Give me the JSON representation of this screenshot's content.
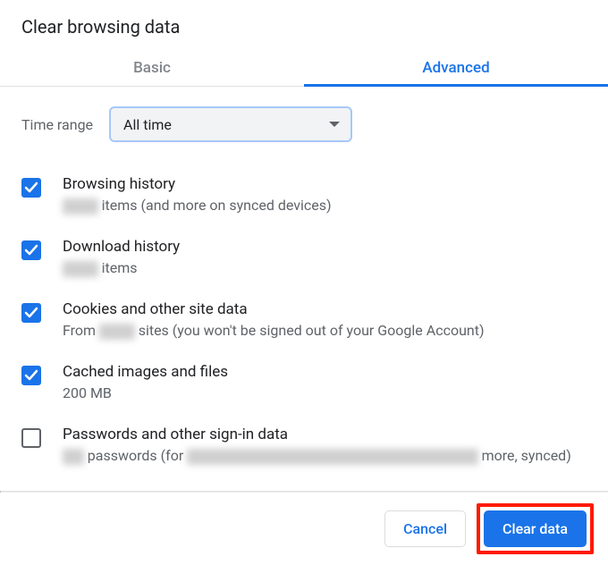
{
  "dialog": {
    "title": "Clear browsing data",
    "tabs": {
      "basic": "Basic",
      "advanced": "Advanced",
      "active": "advanced"
    },
    "time_range": {
      "label": "Time range",
      "value": "All time"
    },
    "options": {
      "browsing_history": {
        "title": "Browsing history",
        "sub_before": "",
        "redacted": "xxxxx",
        "sub_after": " items (and more on synced devices)",
        "checked": true
      },
      "download_history": {
        "title": "Download history",
        "sub_before": "",
        "redacted": "xxxxx",
        "sub_after": " items",
        "checked": true
      },
      "cookies": {
        "title": "Cookies and other site data",
        "sub_before": "From ",
        "redacted": "xxxxx",
        "sub_after": " sites (you won't be signed out of your Google Account)",
        "checked": true
      },
      "cache": {
        "title": "Cached images and files",
        "sub": "200 MB",
        "checked": true
      },
      "passwords": {
        "title": "Passwords and other sign-in data",
        "sub_before": "",
        "redacted1": "xxx",
        "sub_mid": " passwords (for ",
        "redacted2": "xxxxxxxxxxxxxxxxxxxxxxxxxxxxxxxxxxxxxxxxx",
        "sub_after": " more, synced)",
        "checked": false
      }
    },
    "footer": {
      "cancel": "Cancel",
      "clear": "Clear data"
    }
  }
}
